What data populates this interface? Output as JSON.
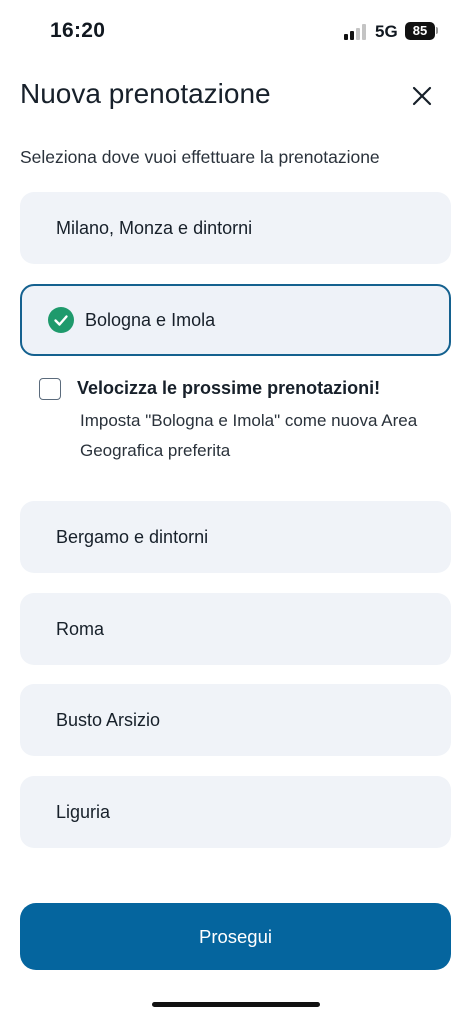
{
  "status_bar": {
    "time": "16:20",
    "network": "5G",
    "battery": "85"
  },
  "header": {
    "title": "Nuova prenotazione",
    "close_icon": "close-icon"
  },
  "subtitle": "Seleziona dove vuoi effettuare la prenotazione",
  "options": [
    {
      "label": "Milano, Monza e dintorni",
      "selected": false
    },
    {
      "label": "Bologna e Imola",
      "selected": true
    },
    {
      "label": "Bergamo e dintorni",
      "selected": false
    },
    {
      "label": "Roma",
      "selected": false
    },
    {
      "label": "Busto Arsizio",
      "selected": false
    },
    {
      "label": "Liguria",
      "selected": false
    }
  ],
  "favorite": {
    "title": "Velocizza le prossime prenotazioni!",
    "description": "Imposta \"Bologna e Imola\" come nuova Area Geografica preferita",
    "checked": false
  },
  "primary_button": {
    "label": "Prosegui"
  },
  "colors": {
    "accent": "#05659e",
    "selected_border": "#14618f",
    "check_green": "#1e9a6c",
    "option_bg": "#f0f3f8"
  }
}
